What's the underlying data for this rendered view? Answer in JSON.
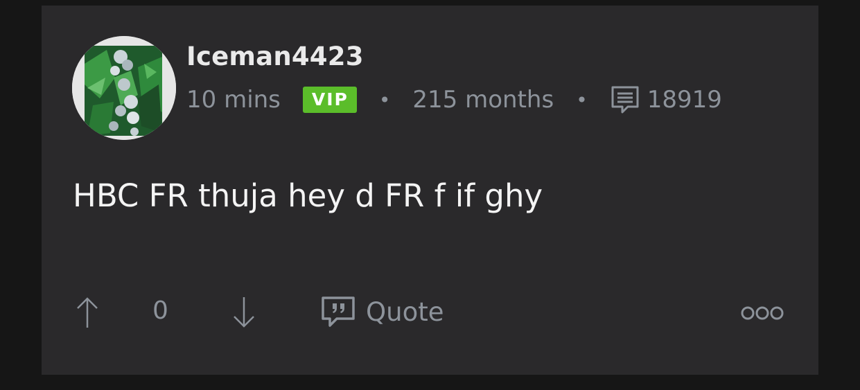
{
  "post": {
    "author": "Iceman4423",
    "time": "10 mins",
    "badge": "VIP",
    "separator": "•",
    "membership": "215 months",
    "comment_count": "18919",
    "body": "HBC FR thuja hey d FR f if ghy",
    "score": "0",
    "quote_label": "Quote"
  },
  "icons": {
    "avatar": "cannabis-plant-photo",
    "comments": "comment-lines-icon",
    "upvote": "arrow-up-icon",
    "downvote": "arrow-down-icon",
    "quote": "quote-bubble-icon",
    "more": "more-options-icon"
  },
  "colors": {
    "page_background": "#161616",
    "card_background": "#2a292b",
    "badge_green": "#5bbd2a",
    "muted_text": "#8d939b",
    "primary_text": "#f4f4f4"
  }
}
